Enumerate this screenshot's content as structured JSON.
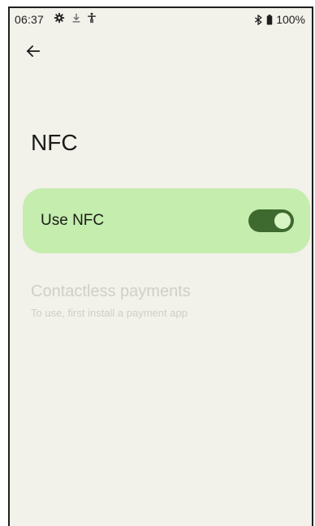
{
  "status_bar": {
    "time": "06:37",
    "battery_text": "100%",
    "icons": [
      "gear-icon",
      "download-icon",
      "accessibility-icon",
      "bluetooth-icon",
      "battery-icon"
    ]
  },
  "header": {
    "back_icon": "arrow-left-icon",
    "title": "NFC"
  },
  "nfc_toggle": {
    "label": "Use NFC",
    "enabled": true
  },
  "contactless": {
    "title": "Contactless payments",
    "subtitle": "To use, first install a payment app",
    "disabled": true
  },
  "colors": {
    "background": "#f2f1ea",
    "card": "#c5edae",
    "toggle_track": "#3f6a2f",
    "toggle_thumb": "#d7f5c4",
    "disabled_text": "#cfcfc7"
  }
}
